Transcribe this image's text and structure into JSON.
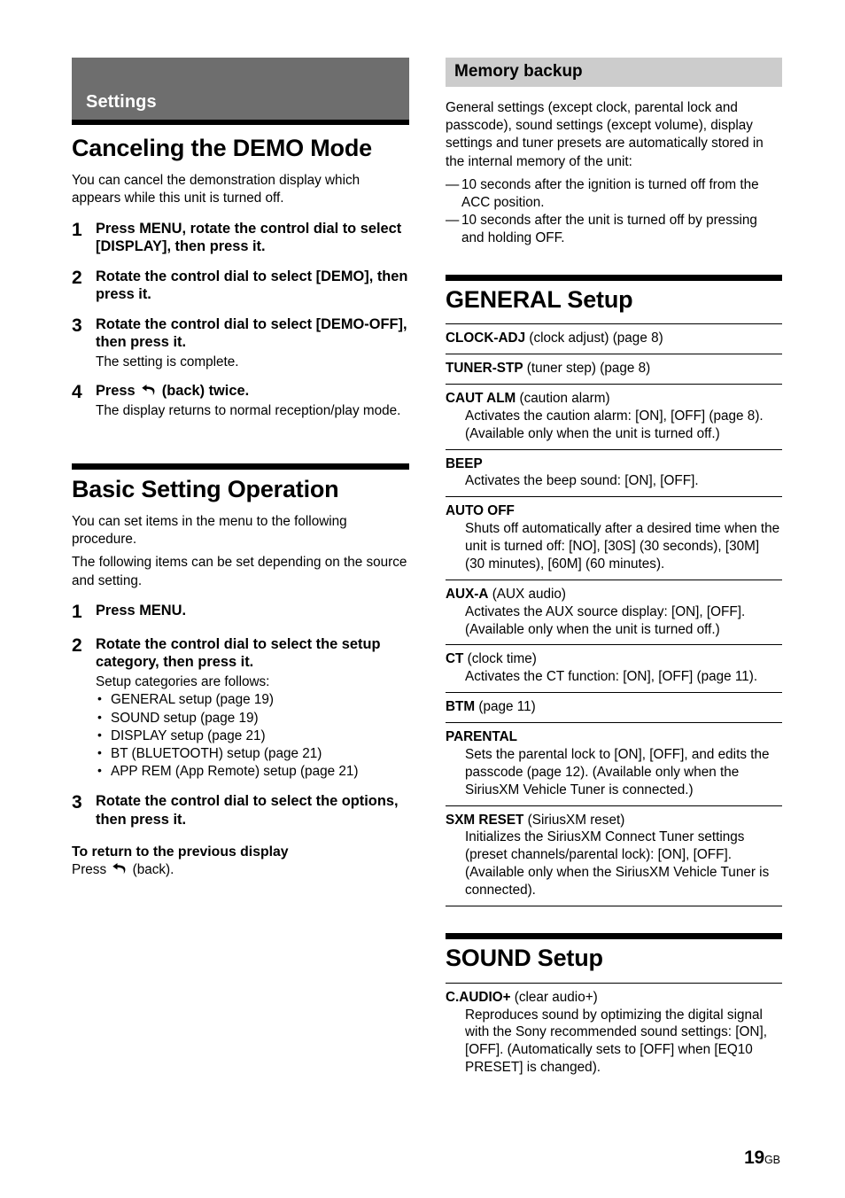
{
  "left_column": {
    "chapter_band": {
      "label": "Settings"
    },
    "section1": {
      "title": "Canceling the DEMO Mode",
      "intro": "You can cancel the demonstration display which appears while this unit is turned off.",
      "steps": [
        {
          "num": "1",
          "title": "Press MENU, rotate the control dial to select [DISPLAY], then press it.",
          "note": ""
        },
        {
          "num": "2",
          "title": "Rotate the control dial to select [DEMO], then press it.",
          "note": ""
        },
        {
          "num": "3",
          "title": "Rotate the control dial to select [DEMO-OFF], then press it.",
          "note": "The setting is complete."
        },
        {
          "num": "4",
          "title_before_icon": "Press ",
          "icon": "back-arrow-icon",
          "title_after_icon": " (back) twice.",
          "note": "The display returns to normal reception/play mode."
        }
      ]
    },
    "section2": {
      "title": "Basic Setting Operation",
      "intro1": "You can set items in the menu to the following procedure.",
      "intro2": "The following items can be set depending on the source and setting.",
      "steps": [
        {
          "num": "1",
          "title": "Press MENU."
        },
        {
          "num": "2",
          "title": "Rotate the control dial to select the setup category, then press it.",
          "note": "Setup categories are follows:"
        },
        {
          "num": "3",
          "title": "Rotate the control dial to select the options, then press it."
        }
      ],
      "categories": [
        "GENERAL setup (page 19)",
        "SOUND setup (page 19)",
        "DISPLAY setup (page 21)",
        "BT (BLUETOOTH) setup (page 21)",
        "APP REM (App Remote) setup (page 21)"
      ],
      "return_subhead": "To return to the previous display",
      "return_before_icon": "Press ",
      "return_icon": "back-arrow-icon",
      "return_after_icon": " (back)."
    }
  },
  "right_column": {
    "memory_backup": {
      "band_label": "Memory backup",
      "paragraph": "General settings (except clock, parental lock and passcode), sound settings (except volume), display settings and tuner presets are automatically stored in the internal memory of the unit:",
      "dashes": [
        "10 seconds after the ignition is turned off from the ACC position.",
        "10 seconds after the unit is turned off by pressing and holding OFF."
      ]
    },
    "general_setup": {
      "title": "GENERAL Setup",
      "items": [
        {
          "term_bold": "CLOCK-ADJ",
          "term_rest": " (clock adjust) (page 8)",
          "desc": ""
        },
        {
          "term_bold": "TUNER-STP",
          "term_rest": " (tuner step) (page 8)",
          "desc": ""
        },
        {
          "term_bold": "CAUT ALM",
          "term_rest": " (caution alarm)",
          "desc": "Activates the caution alarm: [ON], [OFF] (page 8). (Available only when the unit is turned off.)"
        },
        {
          "term_bold": "BEEP",
          "term_rest": "",
          "desc": "Activates the beep sound: [ON], [OFF]."
        },
        {
          "term_bold": "AUTO OFF",
          "term_rest": "",
          "desc": "Shuts off automatically after a desired time when the unit is turned off: [NO], [30S] (30 seconds), [30M] (30 minutes), [60M] (60 minutes)."
        },
        {
          "term_bold": "AUX-A",
          "term_rest": " (AUX audio)",
          "desc": "Activates the AUX source display: [ON], [OFF]. (Available only when the unit is turned off.)"
        },
        {
          "term_bold": "CT",
          "term_rest": " (clock time)",
          "desc": "Activates the CT function: [ON], [OFF] (page 11)."
        },
        {
          "term_bold": "BTM",
          "term_rest": " (page 11)",
          "desc": ""
        },
        {
          "term_bold": "PARENTAL",
          "term_rest": "",
          "desc": "Sets the parental lock to [ON], [OFF], and edits the passcode (page 12). (Available only when the SiriusXM Vehicle Tuner is connected.)"
        },
        {
          "term_bold": "SXM RESET",
          "term_rest": " (SiriusXM reset)",
          "desc": "Initializes the SiriusXM Connect Tuner settings (preset channels/parental lock): [ON], [OFF]. (Available only when the SiriusXM Vehicle Tuner is connected)."
        }
      ]
    },
    "sound_setup": {
      "title": "SOUND Setup",
      "items": [
        {
          "term_bold": "C.AUDIO+",
          "term_rest": " (clear audio+)",
          "desc": "Reproduces sound by optimizing the digital signal with the Sony recommended sound settings: [ON], [OFF]. (Automatically sets to [OFF] when [EQ10 PRESET] is changed)."
        }
      ]
    }
  },
  "footer": {
    "page_number": "19",
    "page_suffix": "GB"
  },
  "colors": {
    "chapter_band_bg": "#6e6e6e",
    "section_band_bg": "#cccccc",
    "rule": "#000000",
    "text": "#000000"
  }
}
